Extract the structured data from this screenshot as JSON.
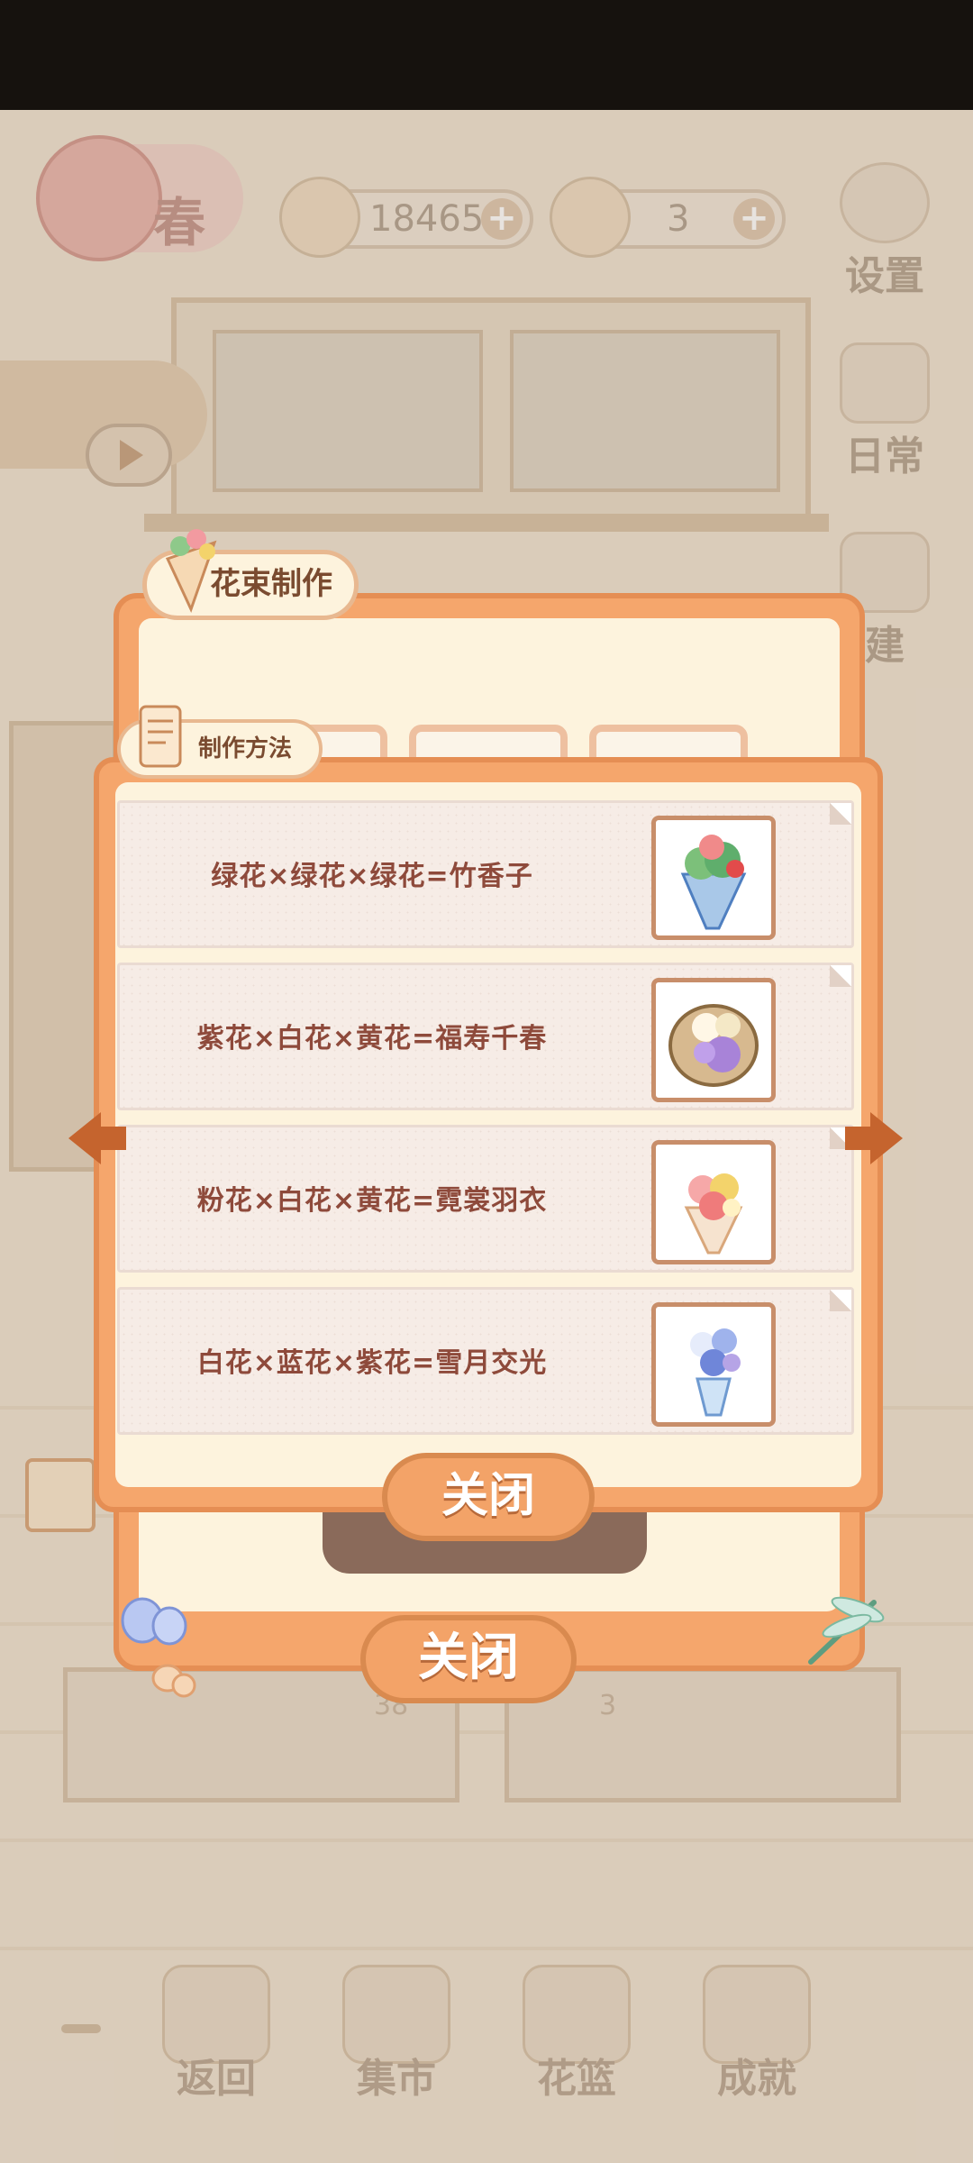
{
  "header": {
    "season_label": "春",
    "fish_currency": "18465",
    "cheese_currency": "3",
    "add_label": "+"
  },
  "side_menu": {
    "settings_label": "设置",
    "daily_label": "日常",
    "build_label": "建"
  },
  "bouquet_panel": {
    "title": "花束制作",
    "close_label": "关闭"
  },
  "recipe_panel": {
    "title": "制作方法",
    "recipes": [
      {
        "text": "绿花×绿花×绿花=竹香子",
        "thumb": "green-bouquet-image"
      },
      {
        "text": "紫花×白花×黄花=福寿千春",
        "thumb": "basket-bouquet-image"
      },
      {
        "text": "粉花×白花×黄花=霓裳羽衣",
        "thumb": "pink-bouquet-image"
      },
      {
        "text": "白花×蓝花×紫花=雪月交光",
        "thumb": "lily-bouquet-image"
      }
    ],
    "close_label": "关闭"
  },
  "background_counts": [
    "38",
    "3"
  ],
  "bottom_nav": [
    {
      "label": "返回",
      "icon": "window-icon"
    },
    {
      "label": "集市",
      "icon": "market-stall-icon"
    },
    {
      "label": "花篮",
      "icon": "flower-basket-icon"
    },
    {
      "label": "成就",
      "icon": "trophy-icon"
    }
  ],
  "colors": {
    "panel_orange": "#f5a66c",
    "panel_border": "#e58e54",
    "panel_cream": "#fdf3dd",
    "recipe_text": "#8e4a3b",
    "arrow": "#c5642e"
  }
}
